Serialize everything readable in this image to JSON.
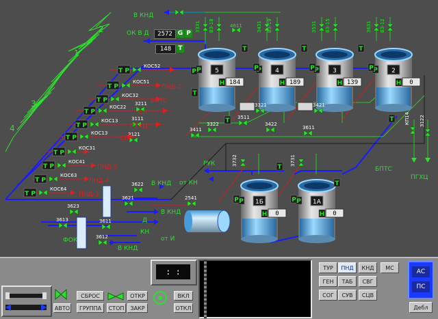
{
  "header": {
    "ok_vd_label": "ОК В Д",
    "ok_vd_value": "2572",
    "g_label": "G",
    "p_label": "P",
    "temp_value": "148",
    "t_label": "T",
    "to_knd_top": "В КНД"
  },
  "valves_top": [
    "3331",
    "В3-18",
    "4611",
    "3431",
    "В3-19",
    "3531",
    "В3-15",
    "3631",
    "В3-12"
  ],
  "tanks": [
    {
      "id": "5",
      "level": "184"
    },
    {
      "id": "4",
      "level": "189"
    },
    {
      "id": "3",
      "level": "139"
    },
    {
      "id": "2",
      "level": "0"
    },
    {
      "id": "1Б",
      "level": "0"
    },
    {
      "id": "1А",
      "level": "0"
    }
  ],
  "hx_numbers": [
    "1",
    "2",
    "3",
    "4"
  ],
  "left_rows": [
    {
      "valve": "КОС52",
      "to": ""
    },
    {
      "valve": "КОС51",
      "to": "ПНД-2"
    },
    {
      "valve": "КОС32",
      "to": "БПТС"
    },
    {
      "valve": "КОС22",
      "to": "СН"
    },
    {
      "valve": "КОС13",
      "to": "ПГХЦ"
    },
    {
      "valve": "КОС13",
      "to": "СПП"
    },
    {
      "valve": "КОС31",
      "to": ""
    },
    {
      "valve": "КОС41",
      "to": "ПНД-5"
    },
    {
      "valve": "КОС63",
      "to": "ПНД-4"
    },
    {
      "valve": "КОС64",
      "to": "ПНД-3"
    }
  ],
  "mid_valves": [
    "3211",
    "3111",
    "3121",
    "3411",
    "3322",
    "3321",
    "3511",
    "3422",
    "3421",
    "3611",
    "КП14",
    "3122"
  ],
  "right_labels": [
    "БПТС",
    "ПГХЦ"
  ],
  "lower": {
    "ruk": "РУК",
    "ot_kn": "от КН",
    "v_knd1": "В КНД",
    "v_knd2": "В КНД",
    "v_knd3": "В КНД",
    "ot_i": "от И",
    "d": "Д",
    "kn": "КН",
    "fok": "ФОК",
    "valves": [
      "3622",
      "3623",
      "3621",
      "3613",
      "3611",
      "3612",
      "2541",
      "3732",
      "3731"
    ]
  },
  "marks": {
    "tp": "Т Р",
    "t": "Т",
    "p": "Р",
    "h": "Н"
  },
  "panel": {
    "sbros": "СБРОС",
    "gruppa": "ГРУППА",
    "avto": "АВТО",
    "otkr": "ОТКР",
    "stop": "СТОП",
    "zakr": "ЗАКР",
    "vkl": "ВКЛ",
    "otkl": "ОТКЛ",
    "clock": ": :",
    "systems": [
      [
        "ТУР",
        "ПНД",
        "КНД",
        "МС"
      ],
      [
        "ГЕН",
        "ТАБ",
        "СВГ"
      ],
      [
        "СОГ",
        "СУВ",
        "СЦВ"
      ]
    ],
    "as": "АС",
    "ps": "ПС",
    "debl": "Дебл"
  }
}
